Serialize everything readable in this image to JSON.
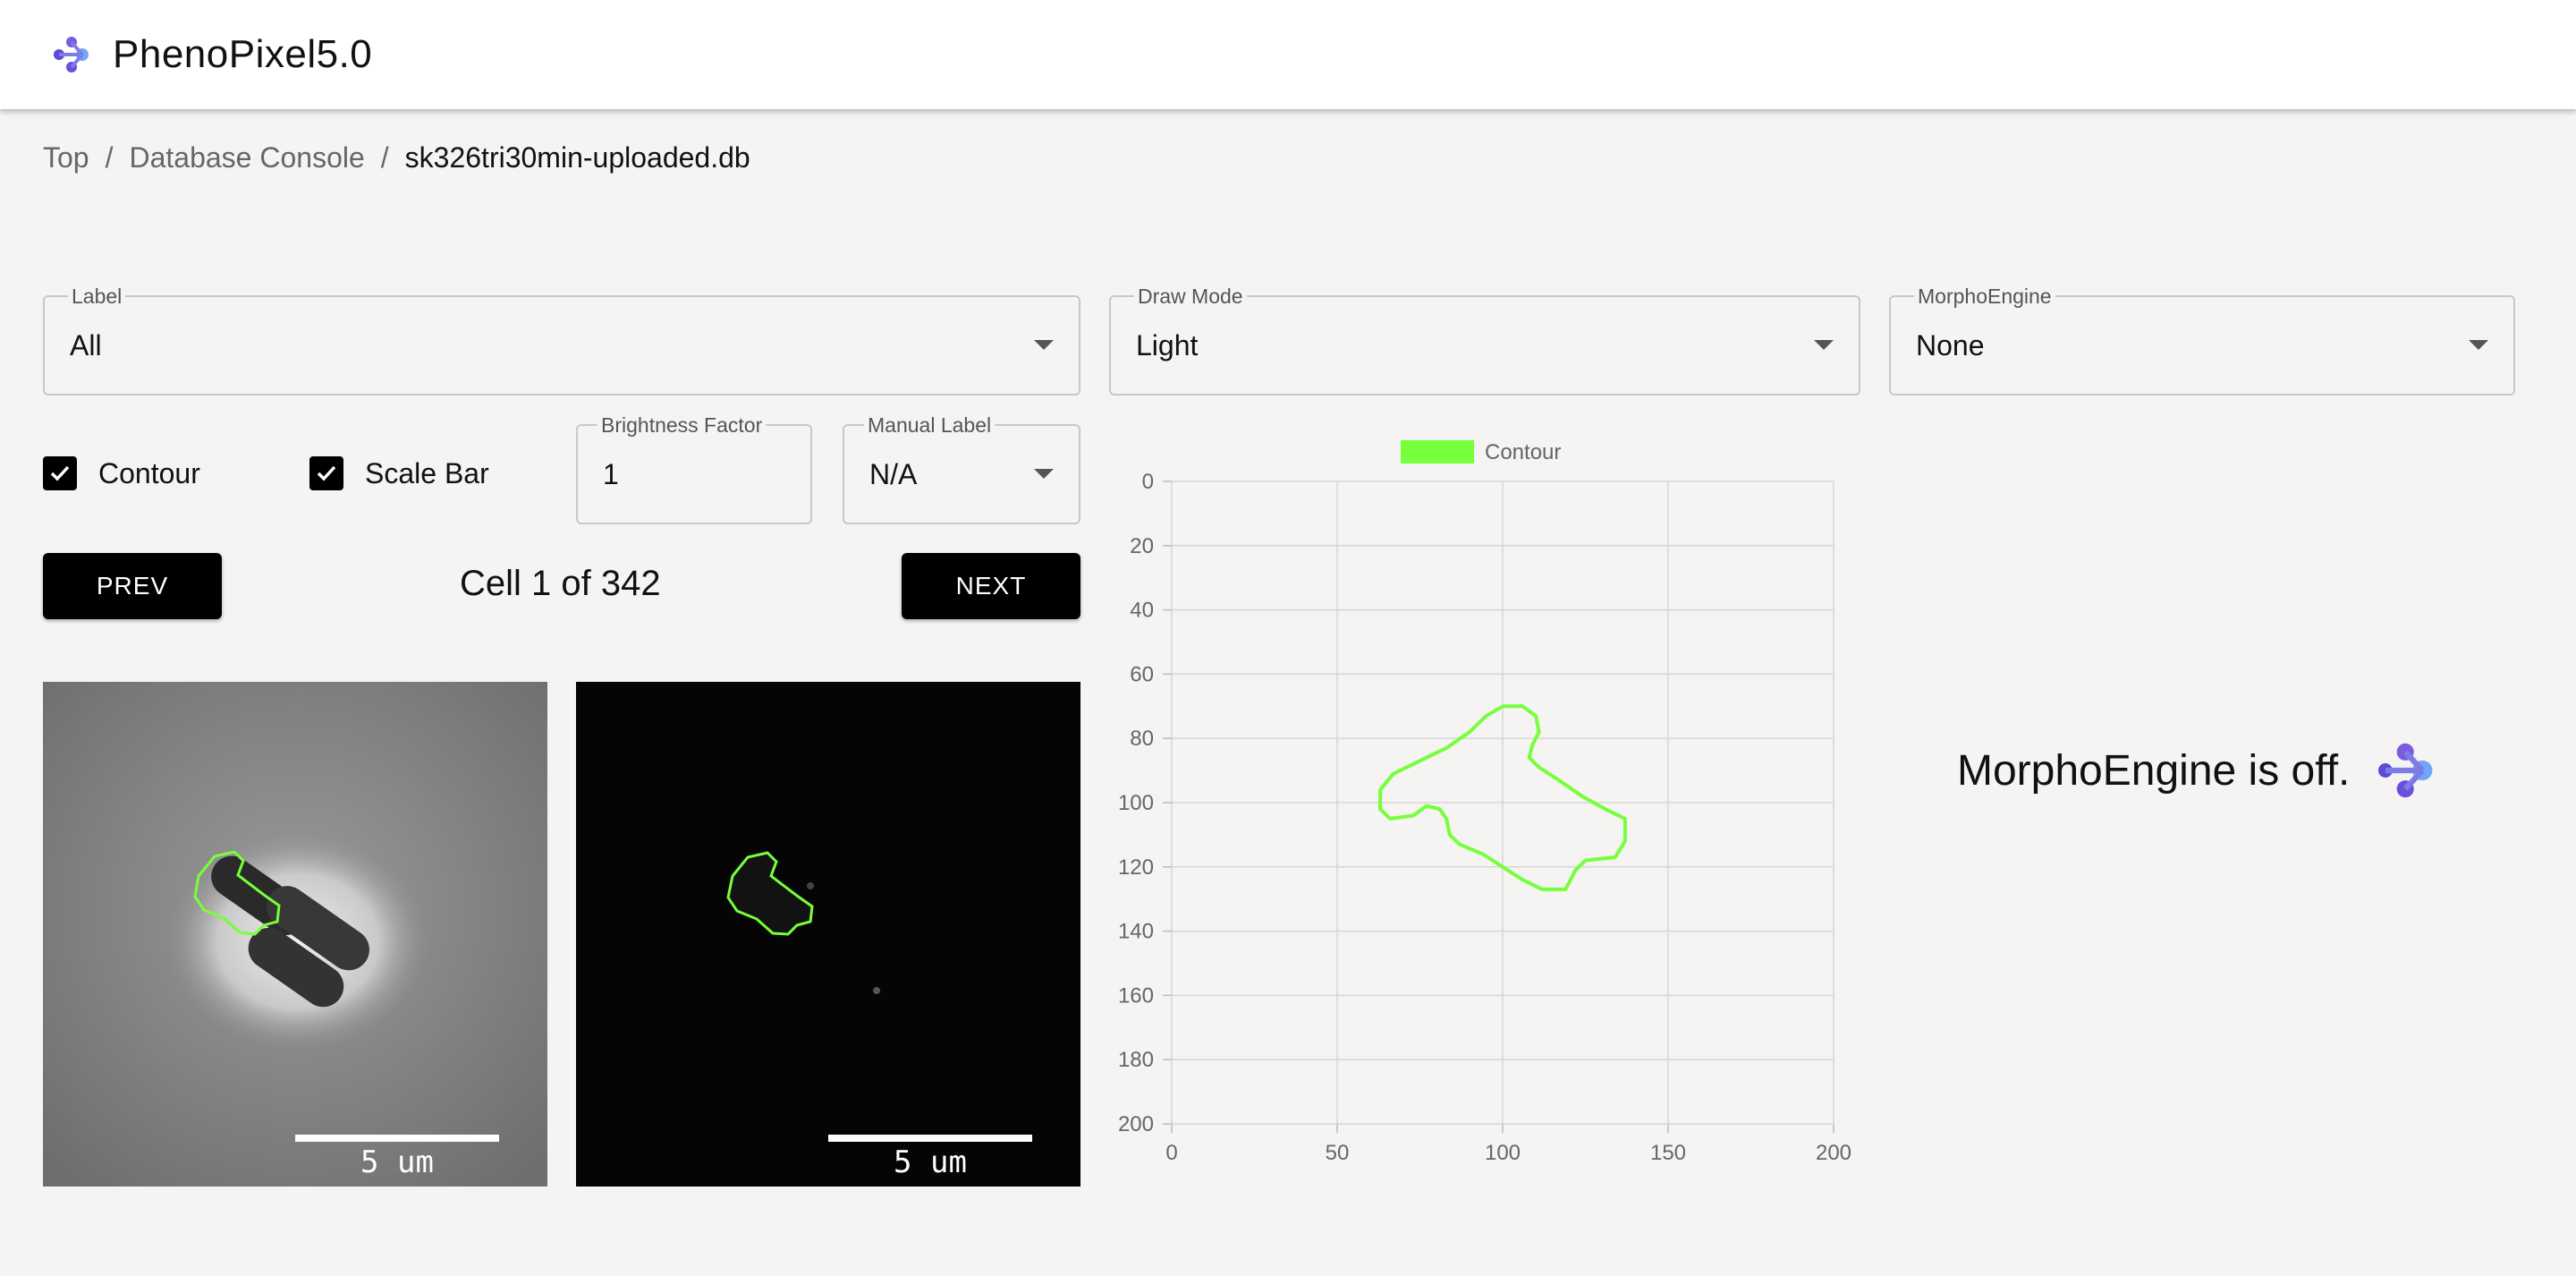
{
  "app": {
    "title": "PhenoPixel5.0",
    "logo_icon": "molecule-logo-icon"
  },
  "breadcrumb": {
    "items": [
      "Top",
      "Database Console",
      "sk326tri30min-uploaded.db"
    ],
    "separator": "/"
  },
  "controls": {
    "label_select": {
      "legend": "Label",
      "value": "All"
    },
    "draw_mode_select": {
      "legend": "Draw Mode",
      "value": "Light"
    },
    "morpho_select": {
      "legend": "MorphoEngine",
      "value": "None"
    },
    "contour_checkbox": {
      "label": "Contour",
      "checked": true
    },
    "scalebar_checkbox": {
      "label": "Scale Bar",
      "checked": true
    },
    "brightness": {
      "legend": "Brightness Factor",
      "value": "1"
    },
    "manual_label": {
      "legend": "Manual Label",
      "value": "N/A"
    },
    "prev_label": "PREV",
    "next_label": "NEXT",
    "counter": "Cell 1 of 342"
  },
  "images": {
    "phase": {
      "scale_label": "5 um"
    },
    "fluo": {
      "scale_label": "5 um"
    }
  },
  "morpho": {
    "message": "MorphoEngine is off."
  },
  "colors": {
    "contour": "#76ff3a",
    "button_bg": "#000000"
  },
  "chart_data": {
    "type": "line",
    "legend": [
      "Contour"
    ],
    "legend_placement": "top-center",
    "xlim": [
      0,
      200
    ],
    "ylim": [
      0,
      200
    ],
    "y_inverted": true,
    "grid": true,
    "x_ticks": [
      0,
      50,
      100,
      150,
      200
    ],
    "y_ticks": [
      0,
      20,
      40,
      60,
      80,
      100,
      120,
      140,
      160,
      180,
      200
    ],
    "series": [
      {
        "name": "Contour",
        "color": "#76ff3a",
        "points": [
          [
            100,
            70
          ],
          [
            106,
            70
          ],
          [
            110,
            73
          ],
          [
            111,
            78
          ],
          [
            109,
            82
          ],
          [
            108,
            86
          ],
          [
            111,
            89
          ],
          [
            117,
            93
          ],
          [
            124,
            98
          ],
          [
            131,
            102
          ],
          [
            137,
            105
          ],
          [
            137,
            112
          ],
          [
            134,
            117
          ],
          [
            125,
            118
          ],
          [
            122,
            121
          ],
          [
            119,
            127
          ],
          [
            112,
            127
          ],
          [
            106,
            124
          ],
          [
            100,
            120
          ],
          [
            94,
            116
          ],
          [
            87,
            113
          ],
          [
            84,
            110
          ],
          [
            83,
            105
          ],
          [
            81,
            102
          ],
          [
            77,
            101
          ],
          [
            73,
            104
          ],
          [
            66,
            105
          ],
          [
            63,
            102
          ],
          [
            63,
            96
          ],
          [
            67,
            91
          ],
          [
            75,
            87
          ],
          [
            83,
            83
          ],
          [
            90,
            78
          ],
          [
            95,
            73
          ],
          [
            100,
            70
          ]
        ]
      }
    ]
  }
}
